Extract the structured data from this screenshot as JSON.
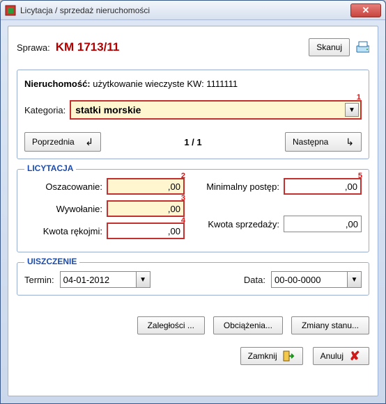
{
  "window": {
    "title": "Licytacja / sprzedaż nieruchomości"
  },
  "top": {
    "sprawa_label": "Sprawa:",
    "sprawa_value": "KM 1713/11",
    "skanuj_label": "Skanuj"
  },
  "nieruchomosc": {
    "label": "Nieruchomość:",
    "value": "użytkowanie wieczyste KW: 1111111",
    "kategoria_label": "Kategoria:",
    "kategoria_value": "statki morskie",
    "req1": "1",
    "prev_label": "Poprzednia",
    "page_indicator": "1 / 1",
    "next_label": "Następna"
  },
  "licytacja": {
    "legend": "LICYTACJA",
    "oszacowanie_label": "Oszacowanie:",
    "oszacowanie_value": ",00",
    "req2": "2",
    "wywolanie_label": "Wywołanie:",
    "wywolanie_value": ",00",
    "req3": "3",
    "rekojmia_label": "Kwota rękojmi:",
    "rekojmia_value": ",00",
    "req4": "4",
    "min_postep_label": "Minimalny postęp:",
    "min_postep_value": ",00",
    "req5": "5",
    "kwota_sprzedazy_label": "Kwota sprzedaży:",
    "kwota_sprzedazy_value": ",00"
  },
  "uiszczenie": {
    "legend": "UISZCZENIE",
    "termin_label": "Termin:",
    "termin_value": "04-01-2012",
    "data_label": "Data:",
    "data_value": "00-00-0000"
  },
  "actions": {
    "zaleglsci": "Zaległości ...",
    "obciazenia": "Obciążenia...",
    "zmiany": "Zmiany stanu..."
  },
  "bottom": {
    "zamknij": "Zamknij",
    "anuluj": "Anuluj"
  }
}
